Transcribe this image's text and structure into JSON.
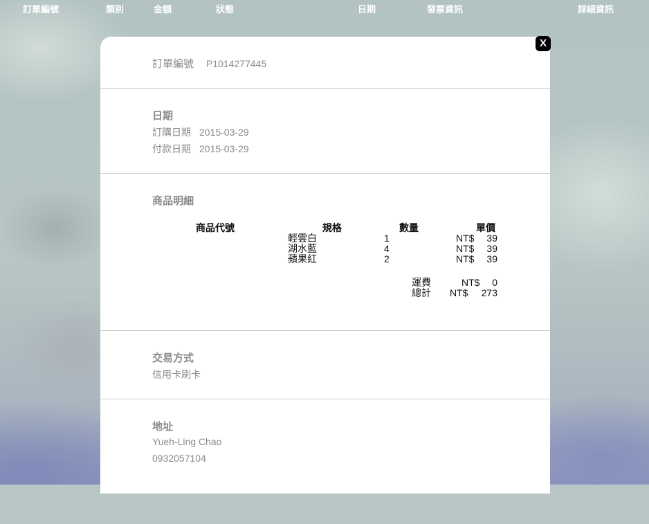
{
  "header": {
    "columns": [
      "訂單編號",
      "類別",
      "金額",
      "狀態",
      "日期",
      "發票資訊",
      "詳細資訊"
    ]
  },
  "modal": {
    "close_label": "X",
    "order": {
      "label": "訂單編號",
      "value": "P1014277445"
    },
    "dates": {
      "title": "日期",
      "order_date_label": "訂購日期",
      "order_date": "2015-03-29",
      "pay_date_label": "付款日期",
      "pay_date": "2015-03-29"
    },
    "items": {
      "title": "商品明細",
      "headers": {
        "code": "商品代號",
        "spec": "規格",
        "qty": "數量",
        "price": "單價"
      },
      "rows": [
        {
          "spec": "輕雲白",
          "qty": "1",
          "currency": "NT$",
          "price": "39"
        },
        {
          "spec": "湖水藍",
          "qty": "4",
          "currency": "NT$",
          "price": "39"
        },
        {
          "spec": "蘋果紅",
          "qty": "2",
          "currency": "NT$",
          "price": "39"
        }
      ],
      "shipping_label": "運費",
      "shipping_currency": "NT$",
      "shipping_value": "0",
      "total_label": "總計",
      "total_currency": "NT$",
      "total_value": "273"
    },
    "payment": {
      "title": "交易方式",
      "method": "信用卡刷卡"
    },
    "address": {
      "title": "地址",
      "name": "Yueh-Ling Chao",
      "phone": "0932057104"
    }
  }
}
